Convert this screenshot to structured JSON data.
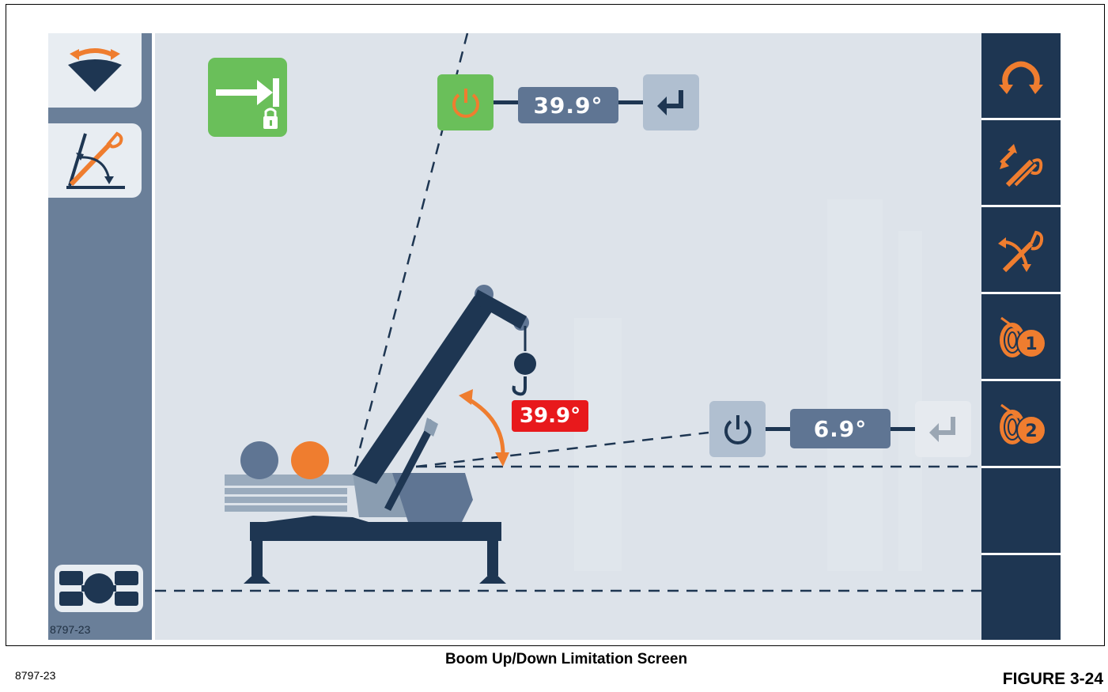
{
  "screen": {
    "upper_limit": {
      "enabled": true,
      "value": "39.9°"
    },
    "lower_limit": {
      "enabled": false,
      "value": "6.9°"
    },
    "current_boom_angle": "39.9°",
    "mode_indicator": {
      "state": "locked",
      "color": "#6abf5a"
    }
  },
  "left_sidebar": {
    "tabs": [
      {
        "icon": "swing-limit-icon",
        "active": true
      },
      {
        "icon": "boom-angle-limit-icon",
        "active": false
      }
    ],
    "bottom_icon": "outrigger-config-icon",
    "code": "8797-23"
  },
  "right_sidebar": {
    "buttons": [
      {
        "icon": "swing-rotation-icon"
      },
      {
        "icon": "boom-telescope-icon"
      },
      {
        "icon": "boom-lift-icon"
      },
      {
        "icon": "winch-1-icon",
        "label": "1"
      },
      {
        "icon": "winch-2-icon",
        "label": "2"
      },
      {
        "icon": "empty-slot"
      },
      {
        "icon": "empty-slot"
      }
    ]
  },
  "colors": {
    "accent_orange": "#ef7d2f",
    "navy": "#1e3652",
    "alarm_red": "#e8191c",
    "ok_green": "#6abf5a"
  },
  "caption": "Boom Up/Down Limitation Screen",
  "figure_code": "8797-23",
  "figure_label": "FIGURE 3-24"
}
